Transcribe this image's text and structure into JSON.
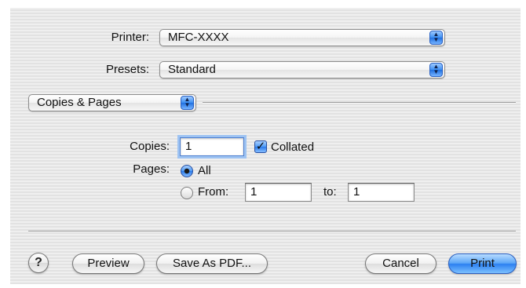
{
  "printer": {
    "label": "Printer:",
    "value": "MFC-XXXX"
  },
  "presets": {
    "label": "Presets:",
    "value": "Standard"
  },
  "panel_menu": {
    "value": "Copies & Pages"
  },
  "copies": {
    "label": "Copies:",
    "value": "1",
    "collated_label": "Collated",
    "collated_checked": true
  },
  "pages": {
    "label": "Pages:",
    "all_label": "All",
    "all_selected": true,
    "from_label": "From:",
    "from_value": "1",
    "to_label": "to:",
    "to_value": "1"
  },
  "buttons": {
    "help": "?",
    "preview": "Preview",
    "save_pdf": "Save As PDF...",
    "cancel": "Cancel",
    "print": "Print"
  },
  "icons": {
    "popup_arrows": "updown-arrows-icon",
    "checkmark": "checkmark-icon",
    "help": "question-mark-icon"
  },
  "colors": {
    "accent": "#3b8ef2",
    "default_button": "#2b7ff0"
  }
}
